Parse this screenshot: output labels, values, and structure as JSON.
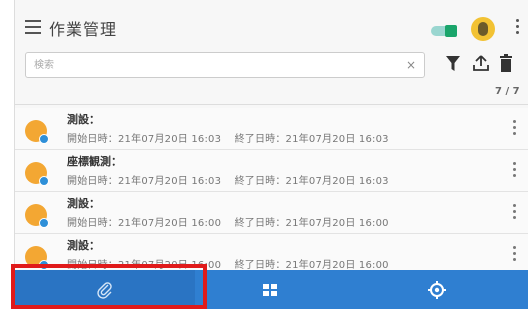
{
  "header": {
    "title": "作業管理",
    "menu_icon": "hamburger-menu-icon",
    "toggle_state": "on",
    "avatar_icon": "user-avatar-icon",
    "more_icon": "more-vertical-icon"
  },
  "search": {
    "placeholder": "検索",
    "clear_label": "×"
  },
  "toolbar": {
    "filter_icon": "filter-icon",
    "upload_icon": "upload-icon",
    "delete_icon": "trash-icon"
  },
  "list": {
    "count": "7 / 7",
    "items": [
      {
        "title": "測設：",
        "start": "開始日時：21年07月20日 16:03",
        "end": "終了日時：21年07月20日 16:03"
      },
      {
        "title": "座標観測：",
        "start": "開始日時：21年07月20日 16:03",
        "end": "終了日時：21年07月20日 16:03"
      },
      {
        "title": "測設：",
        "start": "開始日時：21年07月20日 16:00",
        "end": "終了日時：21年07月20日 16:00"
      },
      {
        "title": "測設：",
        "start": "開始日時：21年07月20日 16:00",
        "end": "終了日時：21年07月20日 16:00"
      }
    ]
  },
  "bottom_nav": {
    "tabs": [
      {
        "icon": "paperclip-icon",
        "selected": true
      },
      {
        "icon": "grid-icon",
        "selected": false
      },
      {
        "icon": "gear-icon",
        "selected": false
      }
    ]
  },
  "colors": {
    "accent": "#2f7fd1",
    "highlight": "#e01a1a",
    "toggle": "#1aa56b"
  }
}
